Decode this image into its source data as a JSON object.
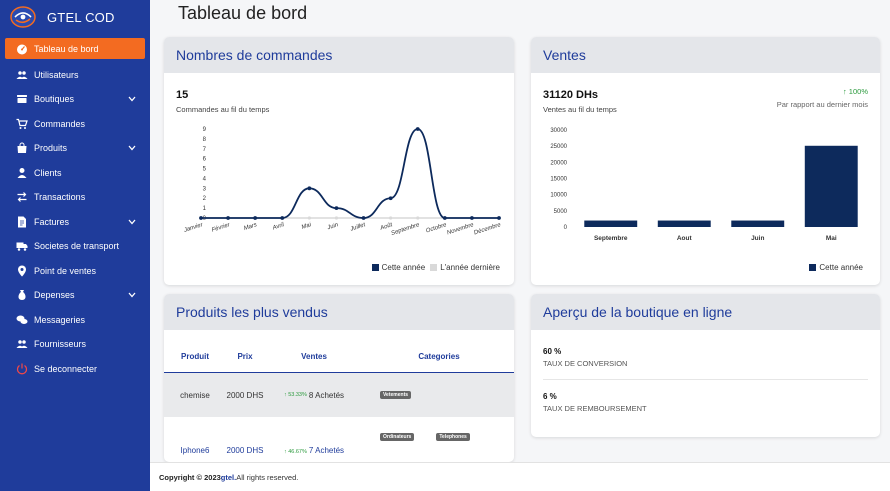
{
  "sidebar": {
    "brand": "GTEL COD",
    "items": [
      {
        "label": "Tableau de bord",
        "icon": "dashboard-icon",
        "active": true,
        "chevron": false
      },
      {
        "label": "Utilisateurs",
        "icon": "users-icon",
        "active": false,
        "chevron": false
      },
      {
        "label": "Boutiques",
        "icon": "store-icon",
        "active": false,
        "chevron": true
      },
      {
        "label": "Commandes",
        "icon": "cart-icon",
        "active": false,
        "chevron": false
      },
      {
        "label": "Produits",
        "icon": "bag-icon",
        "active": false,
        "chevron": true
      },
      {
        "label": "Clients",
        "icon": "user-icon",
        "active": false,
        "chevron": false
      },
      {
        "label": "Transactions",
        "icon": "exchange-icon",
        "active": false,
        "chevron": false
      },
      {
        "label": "Factures",
        "icon": "invoice-icon",
        "active": false,
        "chevron": true
      },
      {
        "label": "Societes de transport",
        "icon": "truck-icon",
        "active": false,
        "chevron": false
      },
      {
        "label": "Point de ventes",
        "icon": "map-pin-icon",
        "active": false,
        "chevron": false
      },
      {
        "label": "Depenses",
        "icon": "money-bag-icon",
        "active": false,
        "chevron": true
      },
      {
        "label": "Messageries",
        "icon": "chat-icon",
        "active": false,
        "chevron": false
      },
      {
        "label": "Fournisseurs",
        "icon": "suppliers-icon",
        "active": false,
        "chevron": false
      },
      {
        "label": "Se deconnecter",
        "icon": "power-icon",
        "active": false,
        "chevron": false
      }
    ]
  },
  "page_title": "Tableau de bord",
  "orders_card": {
    "title": "Nombres de commandes",
    "value": "15",
    "subtitle": "Commandes au fil du temps",
    "legend_current": "Cette année",
    "legend_previous": "L'année dernière"
  },
  "sales_card": {
    "title": "Ventes",
    "value": "31120 DHs",
    "subtitle": "Ventes au fil du temps",
    "change": "↑ 100%",
    "change_caption": "Par rapport au dernier mois",
    "legend_current": "Cette année"
  },
  "top_products": {
    "title": "Produits les plus vendus",
    "headers": [
      "Produit",
      "Prix",
      "Ventes",
      "Categories"
    ],
    "rows": [
      {
        "product": "chemise",
        "price": "2000 DHS",
        "pct": "↑ 53.33%",
        "sales": "8 Achetés",
        "categories": [
          "Vetements"
        ]
      },
      {
        "product": "Iphone6",
        "price": "2000 DHS",
        "pct": "↑ 46.67%",
        "sales": "7 Achetés",
        "categories": [
          "Ordinateurs",
          "Telephones"
        ]
      }
    ]
  },
  "shop_overview": {
    "title": "Aperçu de la boutique en ligne",
    "stats": [
      {
        "value": "60 %",
        "label": "TAUX DE CONVERSION"
      },
      {
        "value": "6 %",
        "label": "TAUX DE REMBOURSEMENT"
      }
    ]
  },
  "footer": {
    "prefix": "Copyright © 2023",
    "brand": "gtel.",
    "suffix": " All rights reserved."
  },
  "colors": {
    "primary": "#1f3c9b",
    "accent": "#f36b21",
    "series_current": "#0d2a5c",
    "series_previous": "#d9d9d9",
    "positive": "#2b9a3d"
  },
  "chart_data": [
    {
      "type": "line",
      "title": "",
      "xlabel": "",
      "ylabel": "",
      "categories": [
        "Janvier",
        "Février",
        "Mars",
        "Avril",
        "Mai",
        "Juin",
        "Juillet",
        "Août",
        "Septembre",
        "Octobre",
        "Novembre",
        "Décembre"
      ],
      "series": [
        {
          "name": "Cette année",
          "values": [
            0,
            0,
            0,
            0,
            3,
            1,
            0,
            2,
            9,
            0,
            0,
            0
          ]
        },
        {
          "name": "L'année dernière",
          "values": [
            0,
            0,
            0,
            0,
            0,
            0,
            0,
            0,
            0,
            0,
            0,
            0
          ]
        }
      ],
      "ylim": [
        0,
        9
      ],
      "yticks": [
        0,
        1,
        2,
        3,
        4,
        5,
        6,
        7,
        8,
        9
      ],
      "legend": "bottom-right",
      "grid": false
    },
    {
      "type": "bar",
      "title": "",
      "xlabel": "",
      "ylabel": "",
      "categories": [
        "Septembre",
        "Aout",
        "Juin",
        "Mai"
      ],
      "series": [
        {
          "name": "Cette année",
          "values": [
            2000,
            2000,
            2000,
            25120
          ]
        }
      ],
      "ylim": [
        0,
        30000
      ],
      "yticks": [
        0,
        5000,
        10000,
        15000,
        20000,
        25000,
        30000
      ],
      "legend": "bottom-right",
      "grid": false
    }
  ]
}
